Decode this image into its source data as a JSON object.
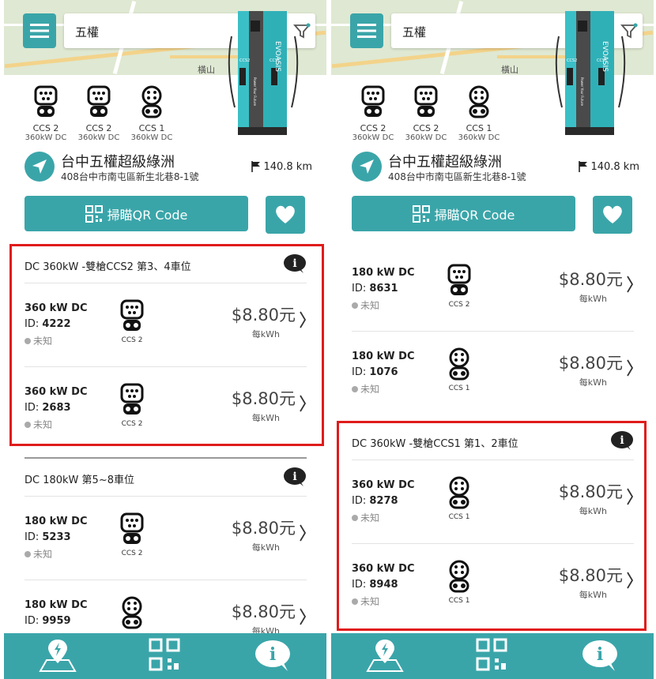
{
  "colors": {
    "teal": "#3aa5a9",
    "highlight": "#e01b1b"
  },
  "screens": [
    {
      "search": {
        "value": "五權"
      },
      "map_label": "橫山",
      "connectors": [
        {
          "icon": "ccs2-connector-icon",
          "label": "CCS 2",
          "sub": "360kW DC"
        },
        {
          "icon": "ccs2-connector-icon",
          "label": "CCS 2",
          "sub": "360kW DC"
        },
        {
          "icon": "ccs1-connector-icon",
          "label": "CCS 1",
          "sub": "360kW DC"
        }
      ],
      "charger_brand": "EVOASIS",
      "charger_ports": [
        "CCS2",
        "CCS1"
      ],
      "charger_slogan": "Power Your Future",
      "station": {
        "name": "台中五權超級綠洲",
        "address": "408台中市南屯區新生北巷8-1號",
        "distance": "140.8 km"
      },
      "qr_button": "掃瞄QR Code",
      "groups": [
        {
          "title": "DC 360kW -雙槍CCS2 第3、4車位",
          "rows": [
            {
              "power": "360 kW DC",
              "id_label": "ID: ",
              "id": "4222",
              "status": "未知",
              "connector": "CCS 2",
              "price": "$8.80元",
              "unit": "每kWh"
            },
            {
              "power": "360 kW DC",
              "id_label": "ID: ",
              "id": "2683",
              "status": "未知",
              "connector": "CCS 2",
              "price": "$8.80元",
              "unit": "每kWh"
            }
          ]
        },
        {
          "title": "DC 180kW 第5~8車位",
          "rows": [
            {
              "power": "180 kW DC",
              "id_label": "ID: ",
              "id": "5233",
              "status": "未知",
              "connector": "CCS 2",
              "price": "$8.80元",
              "unit": "每kWh"
            },
            {
              "power": "180 kW DC",
              "id_label": "ID: ",
              "id": "9959",
              "status": "",
              "connector": "",
              "price": "$8.80元",
              "unit": "每kWh"
            }
          ]
        }
      ]
    },
    {
      "search": {
        "value": "五權"
      },
      "map_label": "橫山",
      "connectors": [
        {
          "icon": "ccs2-connector-icon",
          "label": "CCS 2",
          "sub": "360kW DC"
        },
        {
          "icon": "ccs2-connector-icon",
          "label": "CCS 2",
          "sub": "360kW DC"
        },
        {
          "icon": "ccs1-connector-icon",
          "label": "CCS 1",
          "sub": "360kW DC"
        }
      ],
      "charger_brand": "EVOASIS",
      "charger_ports": [
        "CCS2",
        "CCS1"
      ],
      "charger_slogan": "Power Your Future",
      "station": {
        "name": "台中五權超級綠洲",
        "address": "408台中市南屯區新生北巷8-1號",
        "distance": "140.8 km"
      },
      "qr_button": "掃瞄QR Code",
      "top_rows": [
        {
          "power": "180 kW DC",
          "id_label": "ID: ",
          "id": "8631",
          "status": "未知",
          "connector": "CCS 2",
          "price": "$8.80元",
          "unit": "每kWh"
        },
        {
          "power": "180 kW DC",
          "id_label": "ID: ",
          "id": "1076",
          "status": "未知",
          "connector": "CCS 1",
          "price": "$8.80元",
          "unit": "每kWh"
        }
      ],
      "groups": [
        {
          "title": "DC 360kW -雙槍CCS1 第1、2車位",
          "rows": [
            {
              "power": "360 kW DC",
              "id_label": "ID: ",
              "id": "8278",
              "status": "未知",
              "connector": "CCS 1",
              "price": "$8.80元",
              "unit": "每kWh"
            },
            {
              "power": "360 kW DC",
              "id_label": "ID: ",
              "id": "8948",
              "status": "未知",
              "connector": "CCS 1",
              "price": "$8.80元",
              "unit": "每kWh"
            }
          ]
        }
      ]
    }
  ],
  "bottom_nav": [
    {
      "icon": "map-charging-icon"
    },
    {
      "icon": "qr-code-icon"
    },
    {
      "icon": "info-chat-icon"
    }
  ]
}
